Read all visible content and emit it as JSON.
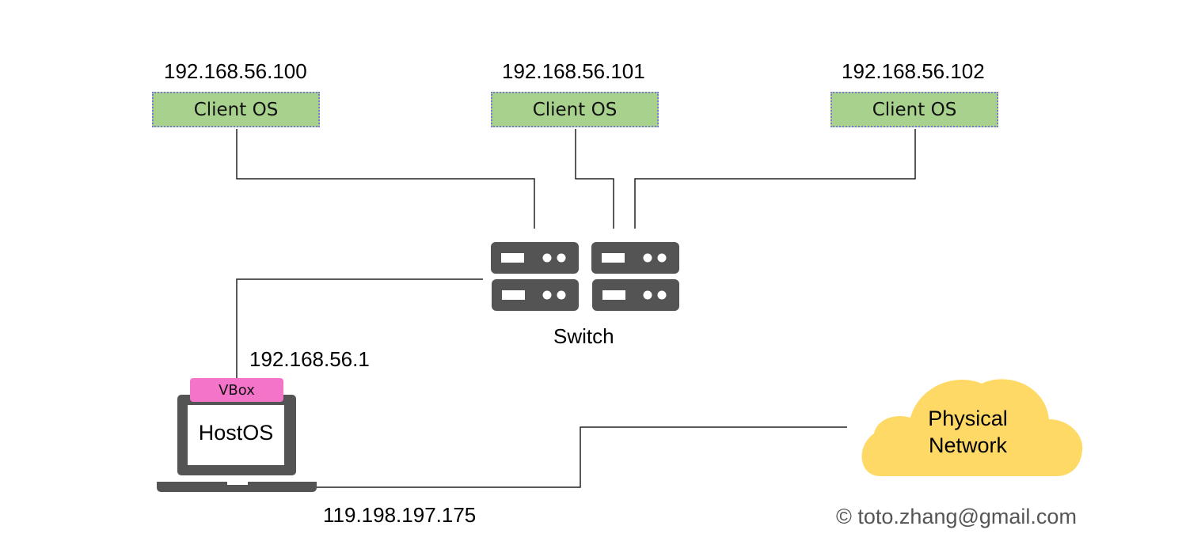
{
  "clients": [
    {
      "ip": "192.168.56.100",
      "label": "Client OS"
    },
    {
      "ip": "192.168.56.101",
      "label": "Client OS"
    },
    {
      "ip": "192.168.56.102",
      "label": "Client OS"
    }
  ],
  "switch": {
    "label": "Switch"
  },
  "host": {
    "vm_label": "VBox",
    "os_label": "HostOS",
    "internal_ip": "192.168.56.1",
    "external_ip": "119.198.197.175"
  },
  "cloud": {
    "line1": "Physical",
    "line2": "Network"
  },
  "footer": {
    "copyright": "© toto.zhang@gmail.com"
  },
  "colors": {
    "client_fill": "#a9d18e",
    "client_border": "#7b7bd0",
    "vbox_fill": "#f374c8",
    "device_gray": "#545454",
    "cloud_fill": "#ffd966"
  }
}
